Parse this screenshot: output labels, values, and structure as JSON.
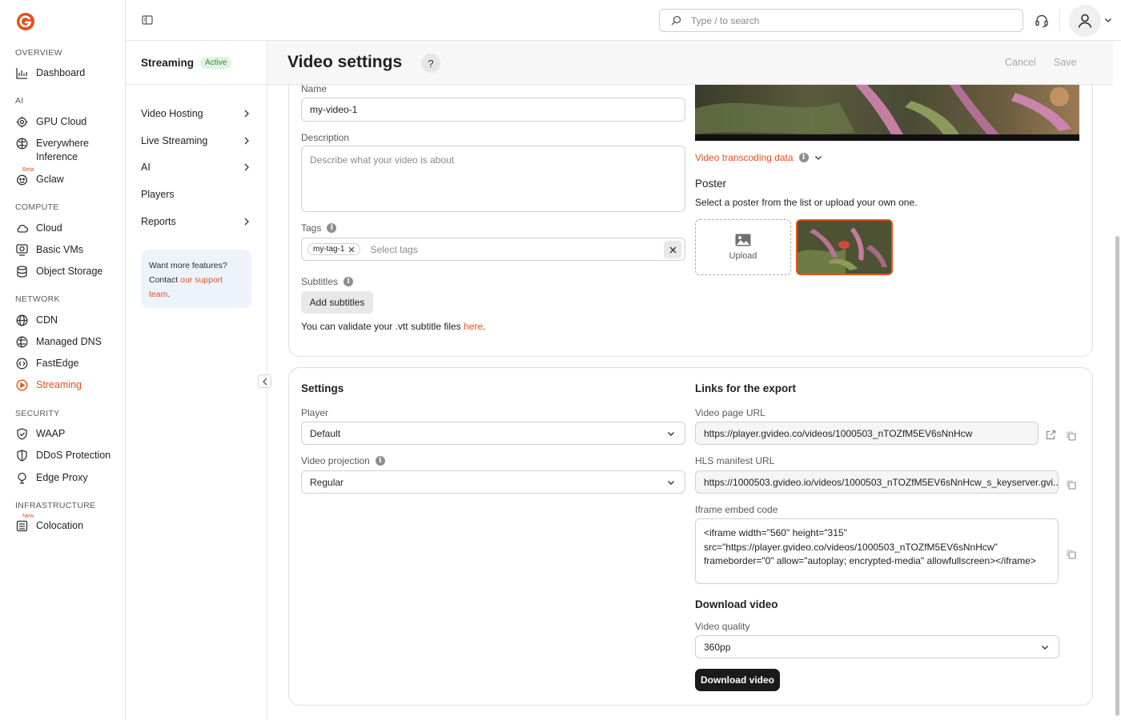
{
  "nav": {
    "sections": [
      {
        "title": "OVERVIEW",
        "items": [
          {
            "label": "Dashboard",
            "icon": "chart-bar-icon"
          }
        ]
      },
      {
        "title": "AI",
        "items": [
          {
            "label": "GPU Cloud",
            "icon": "gpu-icon"
          },
          {
            "label": "Everywhere Inference",
            "icon": "brain-icon"
          },
          {
            "label": "Gclaw",
            "icon": "claw-icon",
            "badge": "Beta"
          }
        ]
      },
      {
        "title": "COMPUTE",
        "items": [
          {
            "label": "Cloud",
            "icon": "cloud-icon"
          },
          {
            "label": "Basic VMs",
            "icon": "vm-icon"
          },
          {
            "label": "Object Storage",
            "icon": "storage-icon"
          }
        ]
      },
      {
        "title": "NETWORK",
        "items": [
          {
            "label": "CDN",
            "icon": "globe-icon"
          },
          {
            "label": "Managed DNS",
            "icon": "dns-icon"
          },
          {
            "label": "FastEdge",
            "icon": "code-icon"
          },
          {
            "label": "Streaming",
            "icon": "streaming-icon"
          }
        ]
      },
      {
        "title": "SECURITY",
        "items": [
          {
            "label": "WAAP",
            "icon": "shield-icon"
          },
          {
            "label": "DDoS Protection",
            "icon": "ddos-icon"
          },
          {
            "label": "Edge Proxy",
            "icon": "proxy-icon"
          }
        ]
      },
      {
        "title": "INFRASTRUCTURE",
        "items": [
          {
            "label": "Colocation",
            "icon": "colocation-icon",
            "badge": "New"
          }
        ]
      }
    ],
    "active": "Streaming"
  },
  "topbar": {
    "search_placeholder": "Type / to search"
  },
  "subnav": {
    "title": "Streaming",
    "status": "Active",
    "items": [
      {
        "label": "Video Hosting",
        "has_chevron": true
      },
      {
        "label": "Live Streaming",
        "has_chevron": true
      },
      {
        "label": "AI",
        "has_chevron": true
      },
      {
        "label": "Players",
        "has_chevron": false
      },
      {
        "label": "Reports",
        "has_chevron": true
      }
    ],
    "promo": {
      "line1": "Want more features?",
      "line2": "Contact ",
      "link": "our support team",
      "end": "."
    }
  },
  "header": {
    "title": "Video settings",
    "help": "?",
    "cancel": "Cancel",
    "save": "Save"
  },
  "details": {
    "name_label": "Name",
    "name_value": "my-video-1",
    "description_label": "Description",
    "description_placeholder": "Describe what your video is about",
    "tags_label": "Tags",
    "tags": [
      "my-tag-1"
    ],
    "tags_placeholder": "Select tags",
    "subtitles_label": "Subtitles",
    "add_subtitles": "Add subtitles",
    "validate_text": "You can validate your .vtt subtitle files ",
    "validate_link": "here",
    "validate_end": ".",
    "transcoding_link": "Video transcoding data",
    "poster_title": "Poster",
    "poster_desc": "Select a poster from the list or upload your own one.",
    "upload": "Upload"
  },
  "settings": {
    "title": "Settings",
    "player_label": "Player",
    "player_value": "Default",
    "projection_label": "Video projection",
    "projection_value": "Regular"
  },
  "export": {
    "title": "Links for the export",
    "page_url_label": "Video page URL",
    "page_url": "https://player.gvideo.co/videos/1000503_nTOZfM5EV6sNnHcw",
    "hls_label": "HLS manifest URL",
    "hls_url": "https://1000503.gvideo.io/videos/1000503_nTOZfM5EV6sNnHcw_s_keyserver.gvi...",
    "iframe_label": "Iframe embed code",
    "iframe_code": "<iframe width=\"560\" height=\"315\" src=\"https://player.gvideo.co/videos/1000503_nTOZfM5EV6sNnHcw\" frameborder=\"0\" allow=\"autoplay; encrypted-media\" allowfullscreen></iframe>"
  },
  "download": {
    "title": "Download video",
    "quality_label": "Video quality",
    "quality_value": "360pp",
    "button": "Download video"
  },
  "colors": {
    "accent": "#e8511c",
    "active_badge_bg": "#dff3e2",
    "active_badge_text": "#2e8b3c",
    "dark_button": "#1a1a1a"
  }
}
